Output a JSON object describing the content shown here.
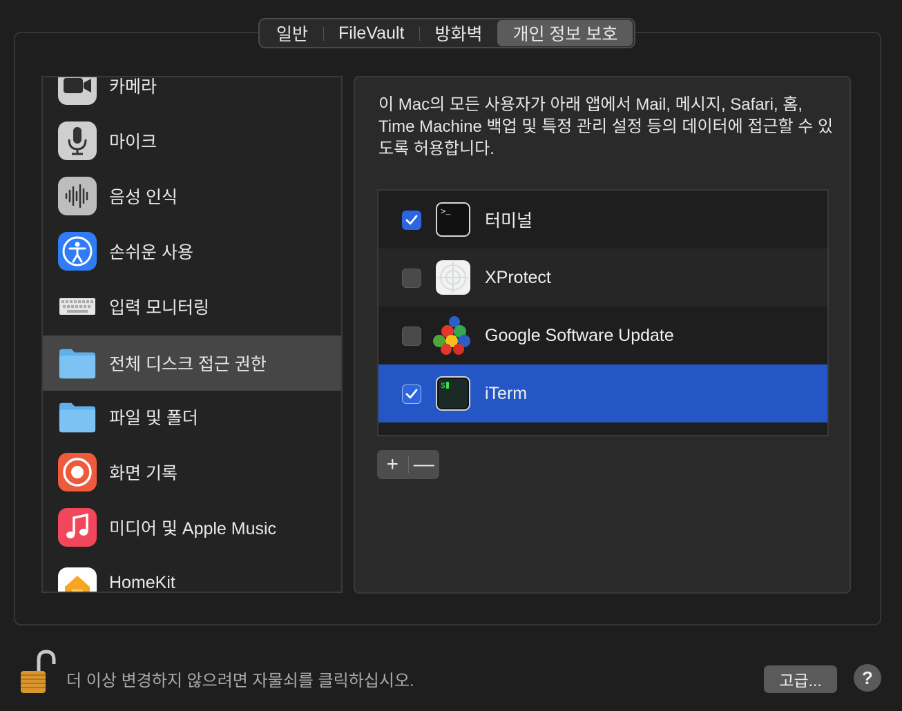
{
  "tabs": [
    {
      "label": "일반",
      "active": false
    },
    {
      "label": "FileVault",
      "active": false
    },
    {
      "label": "방화벽",
      "active": false
    },
    {
      "label": "개인 정보 보호",
      "active": true
    }
  ],
  "sidebar": {
    "items": [
      {
        "label": "카메라",
        "icon": "camera-icon"
      },
      {
        "label": "마이크",
        "icon": "microphone-icon"
      },
      {
        "label": "음성 인식",
        "icon": "waveform-icon"
      },
      {
        "label": "손쉬운 사용",
        "icon": "accessibility-icon"
      },
      {
        "label": "입력 모니터링",
        "icon": "keyboard-icon"
      },
      {
        "label": "전체 디스크 접근 권한",
        "icon": "folder-icon",
        "selected": true
      },
      {
        "label": "파일 및 폴더",
        "icon": "folder-icon"
      },
      {
        "label": "화면 기록",
        "icon": "screen-record-icon"
      },
      {
        "label": "미디어 및 Apple Music",
        "icon": "music-icon"
      },
      {
        "label": "HomeKit",
        "icon": "home-icon"
      }
    ]
  },
  "main": {
    "description": "이 Mac의 모든 사용자가 아래 앱에서 Mail, 메시지, Safari, 홈, Time Machine 백업 및 특정 관리 설정 등의 데이터에 접근할 수 있도록 허용합니다.",
    "apps": [
      {
        "name": "터미널",
        "checked": true,
        "icon": "terminal-icon"
      },
      {
        "name": "XProtect",
        "checked": false,
        "icon": "xprotect-icon"
      },
      {
        "name": "Google Software Update",
        "checked": false,
        "icon": "google-update-icon"
      },
      {
        "name": "iTerm",
        "checked": true,
        "icon": "iterm-icon",
        "selected": true
      }
    ],
    "add_label": "+",
    "remove_label": "—"
  },
  "footer": {
    "lock_text": "더 이상 변경하지 않으려면 자물쇠를 클릭하십시오.",
    "advanced_label": "고급...",
    "help_label": "?"
  },
  "colors": {
    "selection_blue": "#2457c5",
    "checkbox_blue": "#2b66e0",
    "sidebar_selected": "#464646"
  }
}
